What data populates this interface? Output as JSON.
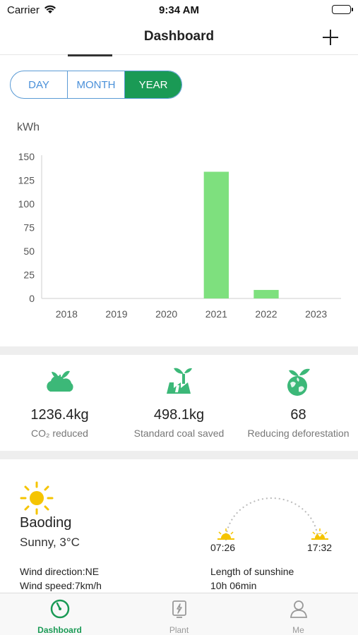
{
  "status_bar": {
    "carrier": "Carrier",
    "time": "9:34 AM"
  },
  "nav": {
    "title": "Dashboard",
    "add_icon": "plus-icon"
  },
  "range_selector": {
    "options": [
      "DAY",
      "MONTH",
      "YEAR"
    ],
    "selected": "YEAR"
  },
  "chart_data": {
    "type": "bar",
    "title": "",
    "xlabel": "",
    "ylabel": "kWh",
    "categories": [
      "2018",
      "2019",
      "2020",
      "2021",
      "2022",
      "2023"
    ],
    "values": [
      0,
      0,
      0,
      134,
      9,
      0
    ],
    "ylim": [
      0,
      150
    ],
    "yticks": [
      "0",
      "25",
      "50",
      "75",
      "100",
      "125",
      "150"
    ],
    "grid": false,
    "bar_color": "#7ee07e"
  },
  "environment": {
    "stats": [
      {
        "value": "1236.4kg",
        "label": "CO₂ reduced",
        "icon": "cloud-leaf-icon"
      },
      {
        "value": "498.1kg",
        "label": "Standard coal saved",
        "icon": "factory-leaf-icon"
      },
      {
        "value": "68",
        "label": "Reducing deforestation",
        "icon": "globe-leaf-icon"
      }
    ]
  },
  "weather": {
    "city": "Baoding",
    "condition": "Sunny,  3°C",
    "wind_direction": "Wind direction:NE",
    "wind_speed": "Wind speed:7km/h",
    "sunrise": "07:26",
    "sunset": "17:32",
    "sunshine_label": "Length of sunshine",
    "sunshine_value": "10h 06min"
  },
  "tab_bar": {
    "items": [
      {
        "label": "Dashboard",
        "icon": "dashboard-icon",
        "active": true
      },
      {
        "label": "Plant",
        "icon": "plant-icon",
        "active": false
      },
      {
        "label": "Me",
        "icon": "user-icon",
        "active": false
      }
    ]
  },
  "colors": {
    "accent": "#1a9a55",
    "segment_border": "#5b9bd5",
    "icon_green": "#3cb878",
    "sun": "#f5c400"
  }
}
